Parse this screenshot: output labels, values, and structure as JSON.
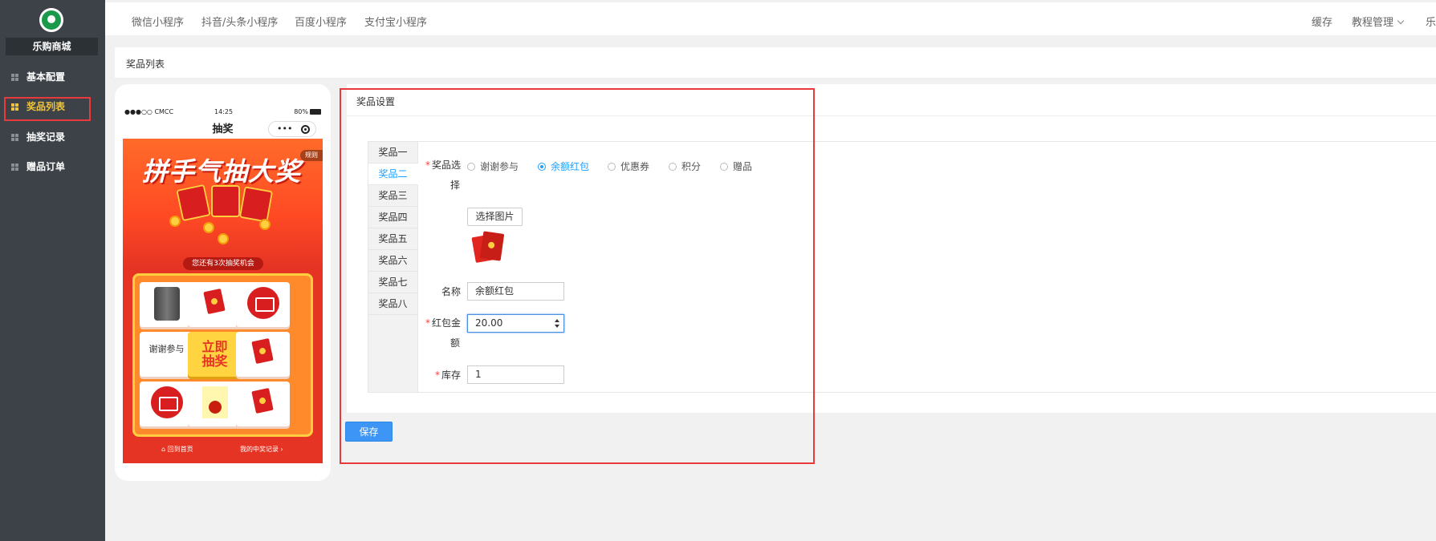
{
  "sidebar": {
    "store_name": "乐购商城",
    "items": [
      {
        "label": "基本配置"
      },
      {
        "label": "奖品列表"
      },
      {
        "label": "抽奖记录"
      },
      {
        "label": "赠品订单"
      }
    ]
  },
  "topbar": {
    "links": [
      "微信小程序",
      "抖音/头条小程序",
      "百度小程序",
      "支付宝小程序"
    ],
    "right_links": [
      "缓存",
      "教程管理",
      "乐"
    ]
  },
  "breadcrumb": "奖品列表",
  "phone": {
    "carrier": "●●●○○ CMCC",
    "time": "14:25",
    "battery": "80%",
    "title": "抽奖",
    "capsule_dots": "•••",
    "banner_title": "拼手气抽大奖",
    "rule": "规则",
    "chances": "您还有3次抽奖机会",
    "cells": {
      "thanks": "谢谢参与",
      "go_line1": "立即",
      "go_line2": "抽奖"
    },
    "footer_home": "回到首页",
    "footer_records": "我的中奖记录"
  },
  "settings": {
    "title": "奖品设置",
    "tabs": [
      "奖品一",
      "奖品二",
      "奖品三",
      "奖品四",
      "奖品五",
      "奖品六",
      "奖品七",
      "奖品八"
    ],
    "type_label_1": "奖品选",
    "type_label_2": "择",
    "types": [
      "谢谢参与",
      "余额红包",
      "优惠券",
      "积分",
      "赠品"
    ],
    "pick_image": "选择图片",
    "name_label": "名称",
    "name_value": "余额红包",
    "amount_label_1": "红包金",
    "amount_label_2": "额",
    "amount_value": "20.00",
    "stock_label": "库存",
    "stock_value": "1",
    "save": "保存"
  },
  "colors": {
    "sidebar_bg": "#3c4248",
    "active_nav": "#f0c43c",
    "primary": "#1e9fff",
    "save_button": "#3d96f5",
    "highlight_frame": "#e83a3a"
  }
}
